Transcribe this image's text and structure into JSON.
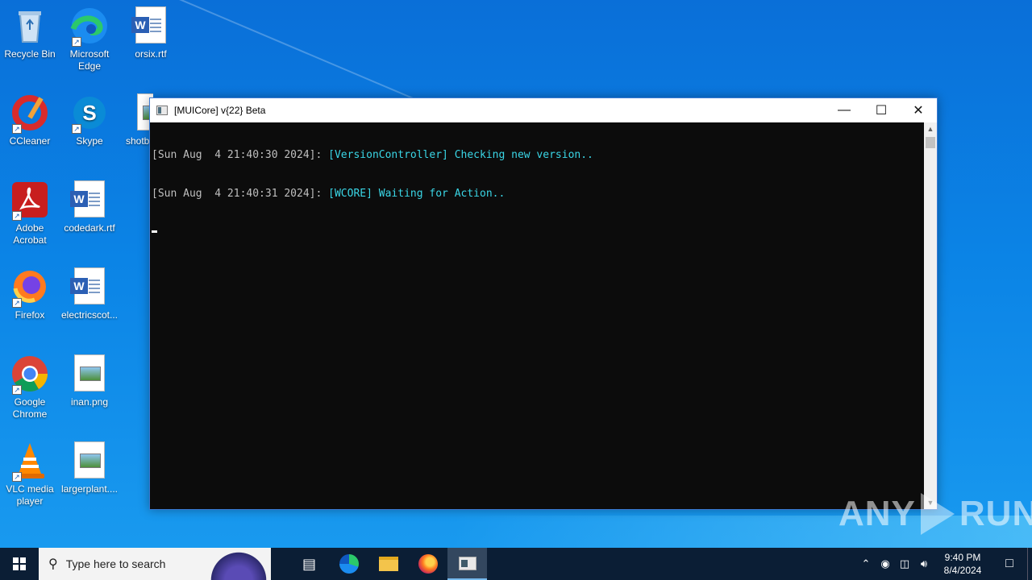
{
  "desktop": {
    "icons": [
      {
        "label": "Recycle Bin"
      },
      {
        "label": "Microsoft Edge"
      },
      {
        "label": "orsix.rtf"
      },
      {
        "label": "CCleaner"
      },
      {
        "label": "Skype"
      },
      {
        "label": "shotb"
      },
      {
        "label": "Adobe Acrobat"
      },
      {
        "label": "codedark.rtf"
      },
      {
        "label": "Firefox"
      },
      {
        "label": "electricscot..."
      },
      {
        "label": "Google Chrome"
      },
      {
        "label": "inan.png"
      },
      {
        "label": "VLC media player"
      },
      {
        "label": "largerplant...."
      }
    ]
  },
  "window": {
    "title": "[MUICore] v{22} Beta",
    "minimize_glyph": "—",
    "maximize_glyph": "☐",
    "close_glyph": "✕",
    "lines": [
      {
        "timestamp": "[Sun Aug  4 21:40:30 2024]: ",
        "message": "[VersionController] Checking new version.."
      },
      {
        "timestamp": "[Sun Aug  4 21:40:31 2024]: ",
        "message": "[WCORE] Waiting for Action.."
      }
    ]
  },
  "watermark": {
    "left": "ANY",
    "right": "RUN"
  },
  "taskbar": {
    "search_placeholder": "Type here to search",
    "clock_time": "9:40 PM",
    "clock_date": "8/4/2024"
  },
  "colors": {
    "console_text": "#3ad6e6",
    "taskbar": "#0b1e35",
    "desktop": "#0b84e6"
  }
}
